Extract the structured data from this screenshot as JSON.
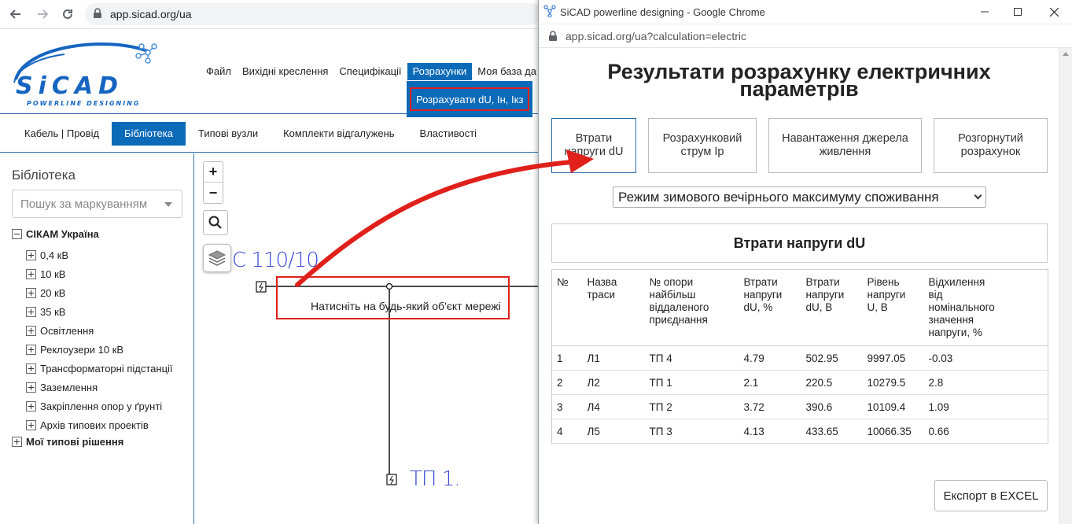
{
  "main_browser": {
    "url": "app.sicad.org/ua"
  },
  "logo": {
    "text": "SiCAD",
    "tagline": "POWERLINE DESIGNING"
  },
  "menu": {
    "items": [
      "Файл",
      "Вихідні креслення",
      "Специфікації",
      "Розрахунки",
      "Моя база да"
    ],
    "active": "Розрахунки",
    "dropdown_item": "Розрахувати dU, Ін, Ікз"
  },
  "tabs": {
    "items": [
      "Кабель | Провід",
      "Бібліотека",
      "Типові вузли",
      "Комплекти відгалужень",
      "Властивості"
    ],
    "active": "Бібліотека"
  },
  "sidebar": {
    "title": "Бібліотека",
    "search_placeholder": "Пошук за маркуванням",
    "tree": {
      "root": "СІКАМ Україна",
      "children": [
        "0,4 кВ",
        "10 кВ",
        "20 кВ",
        "35 кВ",
        "Освітлення",
        "Реклоузери 10 кВ",
        "Трансформаторні підстанції",
        "Заземлення",
        "Закріплення опор у ґрунті",
        "Архів типових проектів"
      ],
      "second_root": "Мої типові рішення"
    }
  },
  "map": {
    "zoom_in": "+",
    "zoom_out": "−",
    "label_substation": "С 110/10.",
    "label_tp": "ТП 1.",
    "hint": "Натисніть на будь-який об'єкт мережі"
  },
  "popup": {
    "window_title": "SiCAD powerline designing - Google Chrome",
    "url": "app.sicad.org/ua?calculation=electric",
    "results_title": "Результати розрахунку електричних параметрів",
    "result_tabs": [
      "Втрати напруги dU",
      "Розрахунковий струм Ір",
      "Навантаження джерела живлення",
      "Розгорнутий розрахунок"
    ],
    "active_tab": "Втрати напруги dU",
    "mode_select": "Режим зимового вечірнього максимуму споживання",
    "section_title": "Втрати напруги dU",
    "table": {
      "headers": [
        "№",
        "Назва траси",
        "№ опори найбільш віддаленого приєднання",
        "Втрати напруги dU, %",
        "Втрати напруги dU, В",
        "Рівень напруги U, В",
        "Відхилення від номінального значення напруги, %"
      ],
      "rows": [
        [
          "1",
          "Л1",
          "ТП 4",
          "4.79",
          "502.95",
          "9997.05",
          "-0.03"
        ],
        [
          "2",
          "Л2",
          "ТП 1",
          "2.1",
          "220.5",
          "10279.5",
          "2.8"
        ],
        [
          "3",
          "Л4",
          "ТП 2",
          "3.72",
          "390.6",
          "10109.4",
          "1.09"
        ],
        [
          "4",
          "Л5",
          "ТП 3",
          "4.13",
          "433.65",
          "10066.35",
          "0.66"
        ]
      ]
    },
    "export_button": "Експорт в EXCEL"
  },
  "colors": {
    "accent_blue": "#0b6bb8",
    "highlight_red": "#e0201b",
    "map_label_blue": "#3a4bd4"
  }
}
